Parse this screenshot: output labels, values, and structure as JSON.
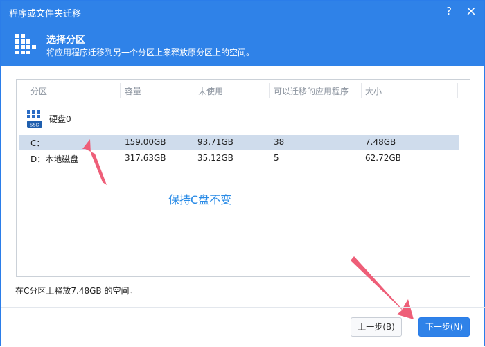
{
  "window": {
    "title": "程序或文件夹迁移",
    "help": "?",
    "close": "×",
    "heading": "选择分区",
    "subtitle": "将应用程序迁移到另一个分区上来释放原分区上的空间。"
  },
  "table": {
    "headers": [
      "分区",
      "容量",
      "未使用",
      "可以迁移的应用程序",
      "大小"
    ],
    "disk": {
      "label": "硬盘0",
      "badge": "SSD"
    },
    "rows": [
      {
        "partition": "C：",
        "capacity": "159.00GB",
        "free": "93.71GB",
        "apps": "38",
        "size": "7.48GB"
      },
      {
        "partition": "D：本地磁盘",
        "capacity": "317.63GB",
        "free": "35.12GB",
        "apps": "5",
        "size": "62.72GB"
      }
    ]
  },
  "annotation": {
    "note": "保持C盘不变",
    "color": "#ee5e78"
  },
  "status": {
    "freed": "在C分区上释放7.48GB 的空间。"
  },
  "buttons": {
    "prev": "上一步(B)",
    "next": "下一步(N)"
  }
}
